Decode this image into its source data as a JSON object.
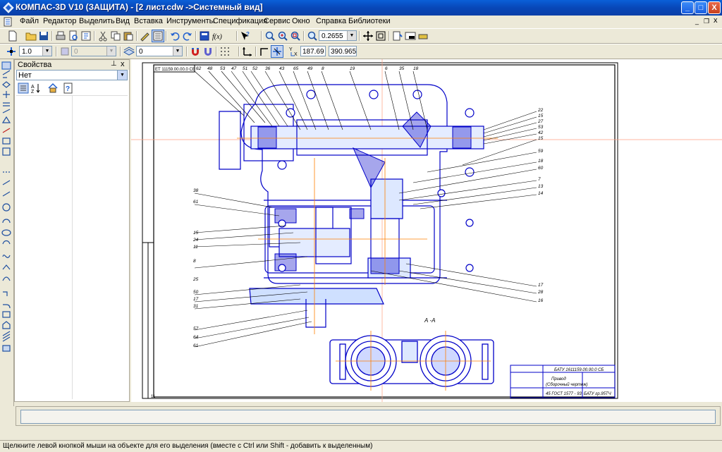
{
  "window": {
    "title": "КОМПАС-3D V10 (ЗАЩИТА) - [2 лист.cdw ->Системный вид]",
    "min": "_",
    "max": "□",
    "close": "X",
    "mdi_min": "_",
    "mdi_restore": "❐",
    "mdi_close": "x"
  },
  "menu": {
    "items": [
      "Файл",
      "Редактор",
      "Выделить",
      "Вид",
      "Вставка",
      "Инструменты",
      "Спецификация",
      "Сервис",
      "Окно",
      "Справка",
      "Библиотеки"
    ]
  },
  "toolbar1": {
    "zoom": "0.2655"
  },
  "toolbar2": {
    "step": "1.0",
    "layer": "0",
    "style": "0",
    "coord_x": "187.69",
    "coord_y": "390.965"
  },
  "props": {
    "title": "Свойства",
    "pin": "⊥",
    "close": "x",
    "selection": "Нет"
  },
  "drawing": {
    "section_label": "А -А",
    "stamp_code": "БАТУ 1611159.00.00.0 СБ",
    "stamp_name_1": "Привод",
    "stamp_name_2": "(Сборочный чертеж)",
    "stamp_material": "45 ГОСТ 1577 - 93",
    "stamp_group": "БАТУ гр.95ТЧ",
    "corner_code": "ЕТ 11159.00.00.0 СБ",
    "leaders_top": [
      "62",
      "48",
      "53",
      "47",
      "51",
      "52",
      "36",
      "43",
      "65",
      "49",
      "8",
      "19",
      "6",
      "35",
      "18"
    ],
    "leaders_right": [
      "22",
      "15",
      "27",
      "53",
      "42",
      "15",
      "59",
      "18",
      "60",
      "7",
      "13",
      "14",
      "17",
      "28",
      "16"
    ],
    "leaders_left": [
      "38",
      "61",
      "15",
      "24",
      "11",
      "8",
      "25",
      "50",
      "17",
      "31",
      "57",
      "64",
      "61"
    ],
    "cursor_label": "11"
  },
  "status": {
    "text": "Щелкните левой кнопкой мыши на объекте для его выделения (вместе с Ctrl или Shift - добавить к выделенным)"
  },
  "colors": {
    "drawing_line": "#0000c8",
    "axis_line": "#ff7f00",
    "title_bar": "#0a5fd8"
  }
}
